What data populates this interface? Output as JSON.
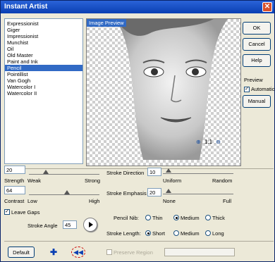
{
  "window": {
    "title": "Instant Artist",
    "close_icon": "close-icon"
  },
  "styles": {
    "items": [
      "Expressionist",
      "Giger",
      "Impressionist",
      "Munchist",
      "Oil",
      "Old Master",
      "Paint and Ink",
      "Pencil",
      "Pointillist",
      "Van Gogh",
      "Watercolor I",
      "Watercolor II"
    ],
    "selected": "Pencil"
  },
  "preview": {
    "label": "Image Preview",
    "zoom_level": "1:1"
  },
  "buttons": {
    "ok": "OK",
    "cancel": "Cancel",
    "help": "Help",
    "manual": "Manual",
    "default": "Default"
  },
  "preview_group": {
    "title": "Preview",
    "automatic": "Automatic",
    "automatic_checked": true
  },
  "strength": {
    "value": "20",
    "low": "Strength",
    "weak": "Weak",
    "strong": "Strong"
  },
  "contrast": {
    "value": "64",
    "low": "Contrast",
    "lowword": "Low",
    "high": "High"
  },
  "leave_gaps": {
    "label": "Leave Gaps",
    "checked": true
  },
  "stroke_angle": {
    "label": "Stroke Angle",
    "value": "45"
  },
  "stroke_direction": {
    "label": "Stroke Direction",
    "value": "10",
    "left": "Uniform",
    "right": "Random"
  },
  "stroke_emphasis": {
    "label": "Stroke Emphasis",
    "value": "20",
    "left": "None",
    "right": "Full"
  },
  "pencil_nib": {
    "label": "Pencil Nib:",
    "options": [
      "Thin",
      "Medium",
      "Thick"
    ],
    "selected": "Medium"
  },
  "stroke_length": {
    "label": "Stroke Length:",
    "options": [
      "Short",
      "Medium",
      "Long"
    ],
    "selected": "Short"
  },
  "preserve_region": {
    "label": "Preserve Region",
    "value": ""
  }
}
